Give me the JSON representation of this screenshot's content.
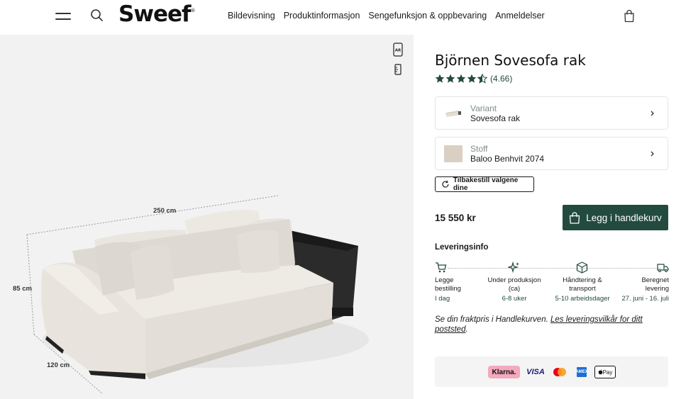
{
  "header": {
    "logo": "Sweef",
    "logo_mark": "®",
    "nav": [
      "Bildevisning",
      "Produktinformasjon",
      "Sengefunksjon & oppbevaring",
      "Anmeldelser"
    ]
  },
  "viewer": {
    "ar_badge": "AR",
    "dimensions": {
      "width": "250 cm",
      "height": "85 cm",
      "depth": "120 cm"
    }
  },
  "product": {
    "title": "Björnen Sovesofa rak",
    "rating": 4.66,
    "rating_text": "(4.66)",
    "variant_label": "Variant",
    "variant_value": "Sovesofa rak",
    "fabric_label": "Stoff",
    "fabric_value": "Baloo Benhvit 2074",
    "reset_label": "Tilbakestill valgene dine",
    "price": "15 550 kr",
    "add_to_cart": "Legg i handlekurv"
  },
  "delivery": {
    "title": "Leveringsinfo",
    "steps": [
      {
        "label": "Legge bestilling",
        "sub": "I dag"
      },
      {
        "label": "Under produksjon (ca)",
        "sub": "6-8 uker"
      },
      {
        "label": "Håndtering & transport",
        "sub": "5-10 arbeidsdager"
      },
      {
        "label": "Beregnet levering",
        "sub": "27. juni - 16. juli"
      }
    ],
    "note_prefix": "Se din fraktpris i Handlekurven. ",
    "note_link": "Les leveringsvilkår for ditt poststed",
    "note_suffix": "."
  },
  "payment": {
    "methods": [
      "Klarna.",
      "VISA",
      "Mastercard",
      "American Express",
      "Apple Pay"
    ],
    "klarna_text": "Klarna.",
    "visa_text": "VISA",
    "amex_text": "AMEX",
    "apple_text": "Pay"
  },
  "colors": {
    "accent": "#234a3f",
    "viewer_bg": "#f2f2f2",
    "klarna_pink": "#f3a9be"
  }
}
